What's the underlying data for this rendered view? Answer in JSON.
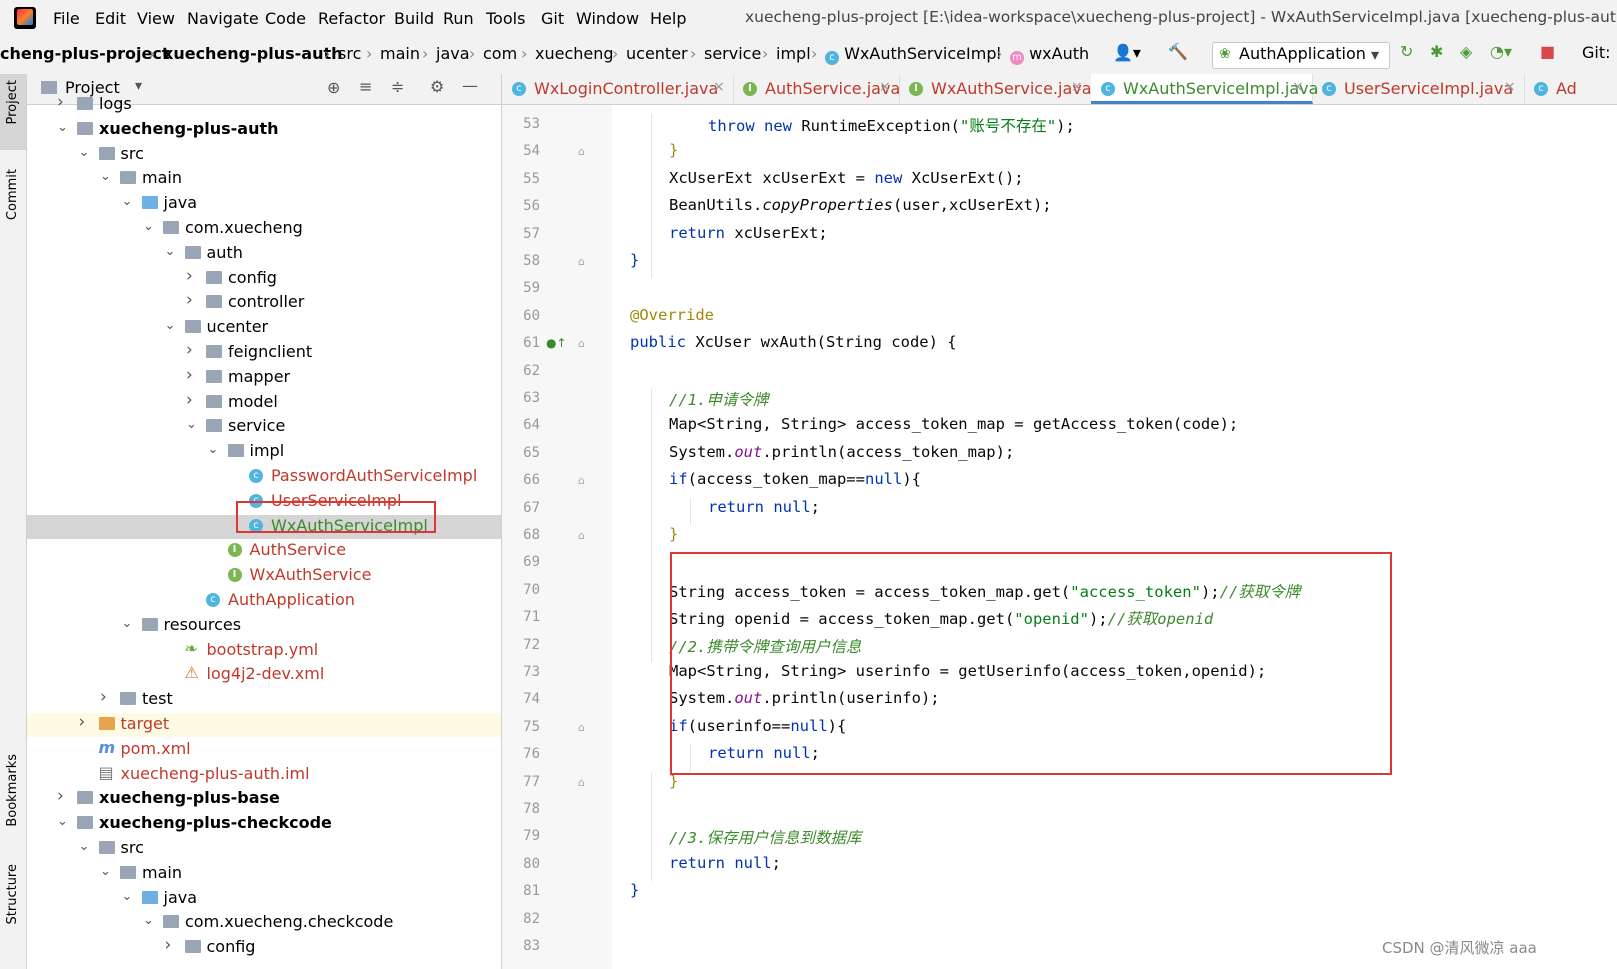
{
  "menu": [
    "File",
    "Edit",
    "View",
    "Navigate",
    "Code",
    "Refactor",
    "Build",
    "Run",
    "Tools",
    "Git",
    "Window",
    "Help"
  ],
  "window_title": "xuecheng-plus-project [E:\\idea-workspace\\xuecheng-plus-project] - WxAuthServiceImpl.java [xuecheng-plus-auth] - Adr",
  "breadcrumbs": [
    "cheng-plus-project",
    "xuecheng-plus-auth",
    "src",
    "main",
    "java",
    "com",
    "xuecheng",
    "ucenter",
    "service",
    "impl",
    "WxAuthServiceImpl",
    "wxAuth"
  ],
  "toolbar": {
    "run_config": "AuthApplication",
    "git_label": "Git:"
  },
  "left_stripe": {
    "project": "Project",
    "commit": "Commit",
    "bookmarks": "Bookmarks",
    "structure": "Structure"
  },
  "project_panel": {
    "title": "Project",
    "tree": [
      {
        "label": "logs",
        "indent": 0,
        "arrow": "›",
        "type": "folder"
      },
      {
        "label": "xuecheng-plus-auth",
        "indent": 0,
        "arrow": "⌄",
        "type": "module",
        "bold": true
      },
      {
        "label": "src",
        "indent": 1,
        "arrow": "⌄",
        "type": "folder"
      },
      {
        "label": "main",
        "indent": 2,
        "arrow": "⌄",
        "type": "folder"
      },
      {
        "label": "java",
        "indent": 3,
        "arrow": "⌄",
        "type": "folder-blue"
      },
      {
        "label": "com.xuecheng",
        "indent": 4,
        "arrow": "⌄",
        "type": "folder"
      },
      {
        "label": "auth",
        "indent": 5,
        "arrow": "⌄",
        "type": "folder"
      },
      {
        "label": "config",
        "indent": 6,
        "arrow": "›",
        "type": "folder"
      },
      {
        "label": "controller",
        "indent": 6,
        "arrow": "›",
        "type": "folder"
      },
      {
        "label": "ucenter",
        "indent": 5,
        "arrow": "⌄",
        "type": "folder"
      },
      {
        "label": "feignclient",
        "indent": 6,
        "arrow": "›",
        "type": "folder"
      },
      {
        "label": "mapper",
        "indent": 6,
        "arrow": "›",
        "type": "folder"
      },
      {
        "label": "model",
        "indent": 6,
        "arrow": "›",
        "type": "folder"
      },
      {
        "label": "service",
        "indent": 6,
        "arrow": "⌄",
        "type": "folder"
      },
      {
        "label": "impl",
        "indent": 7,
        "arrow": "⌄",
        "type": "folder"
      },
      {
        "label": "PasswordAuthServiceImpl",
        "indent": 8,
        "arrow": "",
        "type": "class",
        "color": "red"
      },
      {
        "label": "UserServiceImpl",
        "indent": 8,
        "arrow": "",
        "type": "class",
        "color": "red"
      },
      {
        "label": "WxAuthServiceImpl",
        "indent": 8,
        "arrow": "",
        "type": "class",
        "color": "green",
        "selected": true
      },
      {
        "label": "AuthService",
        "indent": 7,
        "arrow": "",
        "type": "interface",
        "color": "red"
      },
      {
        "label": "WxAuthService",
        "indent": 7,
        "arrow": "",
        "type": "interface",
        "color": "red"
      },
      {
        "label": "AuthApplication",
        "indent": 6,
        "arrow": "",
        "type": "class",
        "color": "red"
      },
      {
        "label": "resources",
        "indent": 3,
        "arrow": "⌄",
        "type": "folder"
      },
      {
        "label": "bootstrap.yml",
        "indent": 5,
        "arrow": "",
        "type": "yml",
        "color": "red"
      },
      {
        "label": "log4j2-dev.xml",
        "indent": 5,
        "arrow": "",
        "type": "xml",
        "color": "red"
      },
      {
        "label": "test",
        "indent": 2,
        "arrow": "›",
        "type": "folder"
      },
      {
        "label": "target",
        "indent": 1,
        "arrow": "›",
        "type": "folder-orange",
        "color": "red",
        "highlight": true
      },
      {
        "label": "pom.xml",
        "indent": 1,
        "arrow": "",
        "type": "pom",
        "color": "red"
      },
      {
        "label": "xuecheng-plus-auth.iml",
        "indent": 1,
        "arrow": "",
        "type": "iml",
        "color": "red"
      },
      {
        "label": "xuecheng-plus-base",
        "indent": 0,
        "arrow": "›",
        "type": "module",
        "bold": true
      },
      {
        "label": "xuecheng-plus-checkcode",
        "indent": 0,
        "arrow": "⌄",
        "type": "module",
        "bold": true
      },
      {
        "label": "src",
        "indent": 1,
        "arrow": "⌄",
        "type": "folder"
      },
      {
        "label": "main",
        "indent": 2,
        "arrow": "⌄",
        "type": "folder"
      },
      {
        "label": "java",
        "indent": 3,
        "arrow": "⌄",
        "type": "folder-blue"
      },
      {
        "label": "com.xuecheng.checkcode",
        "indent": 4,
        "arrow": "⌄",
        "type": "folder"
      },
      {
        "label": "config",
        "indent": 5,
        "arrow": "›",
        "type": "folder"
      }
    ]
  },
  "tabs": [
    {
      "label": "WxLoginController.java",
      "icon": "c",
      "color": "red"
    },
    {
      "label": "AuthService.java",
      "icon": "i",
      "color": "red"
    },
    {
      "label": "WxAuthService.java",
      "icon": "i",
      "color": "red"
    },
    {
      "label": "WxAuthServiceImpl.java",
      "icon": "c",
      "color": "green",
      "active": true
    },
    {
      "label": "UserServiceImpl.java",
      "icon": "c",
      "color": "red"
    },
    {
      "label": "Ad",
      "icon": "c",
      "color": "red"
    }
  ],
  "code_lines": [
    {
      "n": "53",
      "i": 2,
      "h": "<span class='kw'>throw new</span> RuntimeException(<span class='str'>\"账号不存在\"</span>);"
    },
    {
      "n": "54",
      "i": 1,
      "h": "<span class='an'>}</span>"
    },
    {
      "n": "55",
      "i": 1,
      "h": "XcUserExt xcUserExt = <span class='kw'>new</span> XcUserExt();"
    },
    {
      "n": "56",
      "i": 1,
      "h": "BeanUtils.<span class='st'>copyProperties</span>(user,xcUserExt);"
    },
    {
      "n": "57",
      "i": 1,
      "h": "<span class='kw'>return</span> xcUserExt;"
    },
    {
      "n": "58",
      "i": 0,
      "h": "<span class='kw'>}</span>"
    },
    {
      "n": "59",
      "i": 0,
      "h": ""
    },
    {
      "n": "60",
      "i": 0,
      "h": "<span class='an'>@Override</span>"
    },
    {
      "n": "61",
      "i": 0,
      "h": "<span class='kw'>public</span> XcUser wxAuth(String code) {"
    },
    {
      "n": "62",
      "i": 0,
      "h": ""
    },
    {
      "n": "63",
      "i": 1,
      "h": "<span class='cmg'>//1.申请令牌</span>"
    },
    {
      "n": "64",
      "i": 1,
      "h": "Map&lt;String, String&gt; access_token_map = getAccess_token(code);"
    },
    {
      "n": "65",
      "i": 1,
      "h": "System.<span class='fld'>out</span>.println(access_token_map);"
    },
    {
      "n": "66",
      "i": 1,
      "h": "<span class='kw'>if</span>(access_token_map==<span class='kw'>null</span>){"
    },
    {
      "n": "67",
      "i": 2,
      "h": "<span class='kw'>return null</span>;"
    },
    {
      "n": "68",
      "i": 1,
      "h": "<span class='an'>}</span>"
    },
    {
      "n": "69",
      "i": 0,
      "h": ""
    },
    {
      "n": "70",
      "i": 1,
      "h": "String access_token = access_token_map.get(<span class='str'>\"access_token\"</span>);<span class='cmg'>//获取令牌</span>"
    },
    {
      "n": "71",
      "i": 1,
      "h": "String openid = access_token_map.get(<span class='str'>\"openid\"</span>);<span class='cmg'>//获取openid</span>"
    },
    {
      "n": "72",
      "i": 1,
      "h": "<span class='cmg'>//2.携带令牌查询用户信息</span>"
    },
    {
      "n": "73",
      "i": 1,
      "h": "Map&lt;String, String&gt; userinfo = getUserinfo(access_token,openid);"
    },
    {
      "n": "74",
      "i": 1,
      "h": "System.<span class='fld'>out</span>.println(userinfo);"
    },
    {
      "n": "75",
      "i": 1,
      "h": "<span class='kw'>if</span>(userinfo==<span class='kw'>null</span>){"
    },
    {
      "n": "76",
      "i": 2,
      "h": "<span class='kw'>return null</span>;"
    },
    {
      "n": "77",
      "i": 1,
      "h": "<span class='an'>}</span>"
    },
    {
      "n": "78",
      "i": 0,
      "h": ""
    },
    {
      "n": "79",
      "i": 1,
      "h": "<span class='cmg'>//3.保存用户信息到数据库</span>"
    },
    {
      "n": "80",
      "i": 1,
      "h": "<span class='kw'>return null</span>;"
    },
    {
      "n": "81",
      "i": 0,
      "h": "<span class='kw'>}</span>"
    },
    {
      "n": "82",
      "i": 0,
      "h": ""
    },
    {
      "n": "83",
      "i": 0,
      "h": ""
    }
  ],
  "watermark": "CSDN @清风微凉 aaa",
  "colors": {
    "highlight_box": "#e03535",
    "selection": "#d5d5d5",
    "active_tab_underline": "#4083c9"
  }
}
